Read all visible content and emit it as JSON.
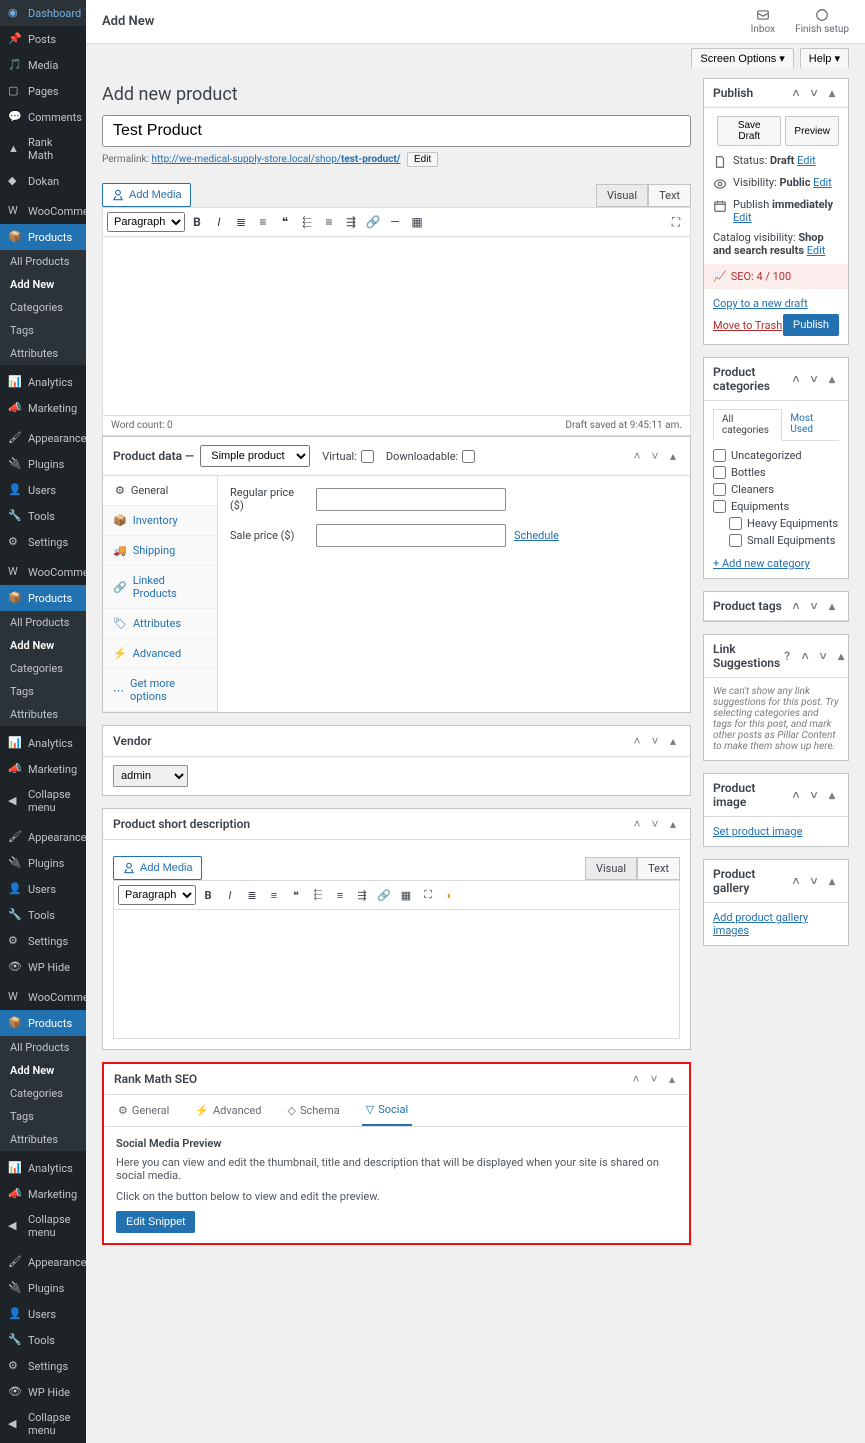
{
  "topbar": {
    "title": "Add New",
    "inbox": "Inbox",
    "finish": "Finish setup"
  },
  "screen_options": "Screen Options ▾",
  "help": "Help ▾",
  "page_title": "Add new product",
  "product_title": "Test Product",
  "permalink": {
    "label": "Permalink:",
    "url": "http://we-medical-supply-store.local/shop/",
    "slug": "test-product/",
    "edit": "Edit"
  },
  "add_media": "Add Media",
  "editor": {
    "visual": "Visual",
    "text": "Text",
    "paragraph": "Paragraph",
    "word_count": "Word count: 0",
    "draft_saved": "Draft saved at 9:45:11 am."
  },
  "product_data": {
    "title": "Product data —",
    "type": "Simple product",
    "virtual": "Virtual:",
    "downloadable": "Downloadable:",
    "tabs": [
      "General",
      "Inventory",
      "Shipping",
      "Linked Products",
      "Attributes",
      "Advanced",
      "Get more options"
    ],
    "regular_price": "Regular price ($)",
    "sale_price": "Sale price ($)",
    "schedule": "Schedule"
  },
  "vendor": {
    "title": "Vendor",
    "value": "admin"
  },
  "short_desc": "Product short description",
  "seo": {
    "title": "Rank Math SEO",
    "tabs": [
      "General",
      "Advanced",
      "Schema",
      "Social"
    ],
    "heading": "Social Media Preview",
    "p1": "Here you can view and edit the thumbnail, title and description that will be displayed when your site is shared on social media.",
    "p2": "Click on the button below to view and edit the preview.",
    "btn": "Edit Snippet"
  },
  "sidebar": {
    "groups": [
      [
        "Dashboard",
        "Posts",
        "Media",
        "Pages",
        "Comments",
        "Rank Math",
        "Dokan"
      ],
      [
        "WooCommerce",
        "Products"
      ],
      [
        "Analytics",
        "Marketing"
      ],
      [
        "Appearance",
        "Plugins",
        "Users",
        "Tools",
        "Settings"
      ],
      [
        "WooCommerce",
        "Products"
      ],
      [
        "Analytics",
        "Marketing"
      ],
      [
        "Appearance",
        "Plugins",
        "Users",
        "Tools",
        "Settings",
        "WP Hide"
      ],
      [
        "WooCommerce",
        "Products"
      ],
      [
        "Analytics",
        "Marketing"
      ],
      [
        "Appearance",
        "Plugins",
        "Users",
        "Tools",
        "Settings",
        "WP Hide"
      ]
    ],
    "sub": [
      "All Products",
      "Add New",
      "Categories",
      "Tags",
      "Attributes"
    ],
    "collapse": "Collapse menu"
  },
  "publish": {
    "title": "Publish",
    "save_draft": "Save Draft",
    "preview": "Preview",
    "status_l": "Status:",
    "status_v": "Draft",
    "edit": "Edit",
    "vis_l": "Visibility:",
    "vis_v": "Public",
    "pub_l": "Publish",
    "pub_v": "immediately",
    "catalog": "Catalog visibility:",
    "catalog_v": "Shop and search results",
    "seo_score": "SEO: 4 / 100",
    "copy": "Copy to a new draft",
    "trash": "Move to Trash",
    "publish_btn": "Publish"
  },
  "categories": {
    "title": "Product categories",
    "all": "All categories",
    "most": "Most Used",
    "items": [
      "Uncategorized",
      "Bottles",
      "Cleaners",
      "Equipments",
      "Heavy Equipments",
      "Small Equipments"
    ],
    "add": "+ Add new category"
  },
  "tags": {
    "title": "Product tags"
  },
  "links": {
    "title": "Link Suggestions",
    "text": "We can't show any link suggestions for this post. Try selecting categories and tags for this post, and mark other posts as Pillar Content to make them show up here."
  },
  "pimage": {
    "title": "Product image",
    "link": "Set product image"
  },
  "pgallery": {
    "title": "Product gallery",
    "link": "Add product gallery images"
  }
}
